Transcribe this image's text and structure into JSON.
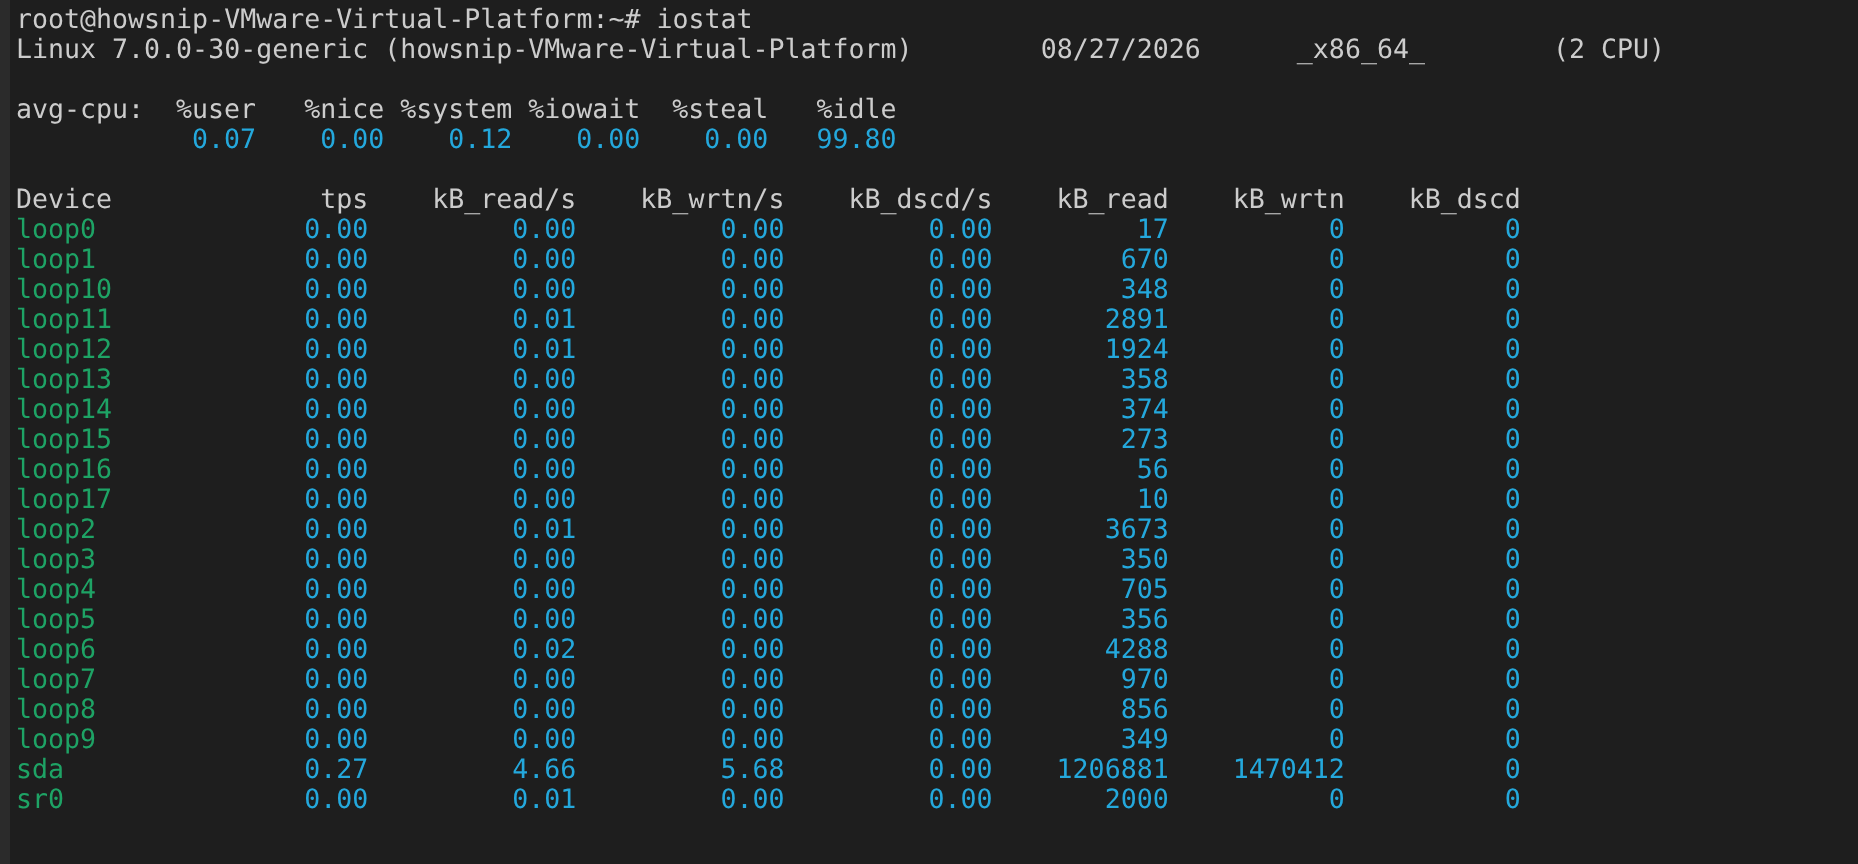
{
  "prompt": {
    "text": "root@howsnip-VMware-Virtual-Platform:~# iostat"
  },
  "system_line": {
    "kernel": "Linux 7.0.0-30-generic (howsnip-VMware-Virtual-Platform)",
    "date": "08/27/2026",
    "arch": "_x86_64_",
    "cpus": "(2 CPU)"
  },
  "avg_cpu": {
    "label": "avg-cpu:",
    "columns": [
      "%user",
      "%nice",
      "%system",
      "%iowait",
      "%steal",
      "%idle"
    ],
    "values": [
      "0.07",
      "0.00",
      "0.12",
      "0.00",
      "0.00",
      "99.80"
    ]
  },
  "devices": {
    "columns": [
      "Device",
      "tps",
      "kB_read/s",
      "kB_wrtn/s",
      "kB_dscd/s",
      "kB_read",
      "kB_wrtn",
      "kB_dscd"
    ],
    "rows": [
      {
        "device": "loop0",
        "values": [
          "0.00",
          "0.00",
          "0.00",
          "0.00",
          "17",
          "0",
          "0"
        ]
      },
      {
        "device": "loop1",
        "values": [
          "0.00",
          "0.00",
          "0.00",
          "0.00",
          "670",
          "0",
          "0"
        ]
      },
      {
        "device": "loop10",
        "values": [
          "0.00",
          "0.00",
          "0.00",
          "0.00",
          "348",
          "0",
          "0"
        ]
      },
      {
        "device": "loop11",
        "values": [
          "0.00",
          "0.01",
          "0.00",
          "0.00",
          "2891",
          "0",
          "0"
        ]
      },
      {
        "device": "loop12",
        "values": [
          "0.00",
          "0.01",
          "0.00",
          "0.00",
          "1924",
          "0",
          "0"
        ]
      },
      {
        "device": "loop13",
        "values": [
          "0.00",
          "0.00",
          "0.00",
          "0.00",
          "358",
          "0",
          "0"
        ]
      },
      {
        "device": "loop14",
        "values": [
          "0.00",
          "0.00",
          "0.00",
          "0.00",
          "374",
          "0",
          "0"
        ]
      },
      {
        "device": "loop15",
        "values": [
          "0.00",
          "0.00",
          "0.00",
          "0.00",
          "273",
          "0",
          "0"
        ]
      },
      {
        "device": "loop16",
        "values": [
          "0.00",
          "0.00",
          "0.00",
          "0.00",
          "56",
          "0",
          "0"
        ]
      },
      {
        "device": "loop17",
        "values": [
          "0.00",
          "0.00",
          "0.00",
          "0.00",
          "10",
          "0",
          "0"
        ]
      },
      {
        "device": "loop2",
        "values": [
          "0.00",
          "0.01",
          "0.00",
          "0.00",
          "3673",
          "0",
          "0"
        ]
      },
      {
        "device": "loop3",
        "values": [
          "0.00",
          "0.00",
          "0.00",
          "0.00",
          "350",
          "0",
          "0"
        ]
      },
      {
        "device": "loop4",
        "values": [
          "0.00",
          "0.00",
          "0.00",
          "0.00",
          "705",
          "0",
          "0"
        ]
      },
      {
        "device": "loop5",
        "values": [
          "0.00",
          "0.00",
          "0.00",
          "0.00",
          "356",
          "0",
          "0"
        ]
      },
      {
        "device": "loop6",
        "values": [
          "0.00",
          "0.02",
          "0.00",
          "0.00",
          "4288",
          "0",
          "0"
        ]
      },
      {
        "device": "loop7",
        "values": [
          "0.00",
          "0.00",
          "0.00",
          "0.00",
          "970",
          "0",
          "0"
        ]
      },
      {
        "device": "loop8",
        "values": [
          "0.00",
          "0.00",
          "0.00",
          "0.00",
          "856",
          "0",
          "0"
        ]
      },
      {
        "device": "loop9",
        "values": [
          "0.00",
          "0.00",
          "0.00",
          "0.00",
          "349",
          "0",
          "0"
        ]
      },
      {
        "device": "sda",
        "values": [
          "0.27",
          "4.66",
          "5.68",
          "0.00",
          "1206881",
          "1470412",
          "0"
        ]
      },
      {
        "device": "sr0",
        "values": [
          "0.00",
          "0.01",
          "0.00",
          "0.00",
          "2000",
          "0",
          "0"
        ]
      }
    ]
  }
}
